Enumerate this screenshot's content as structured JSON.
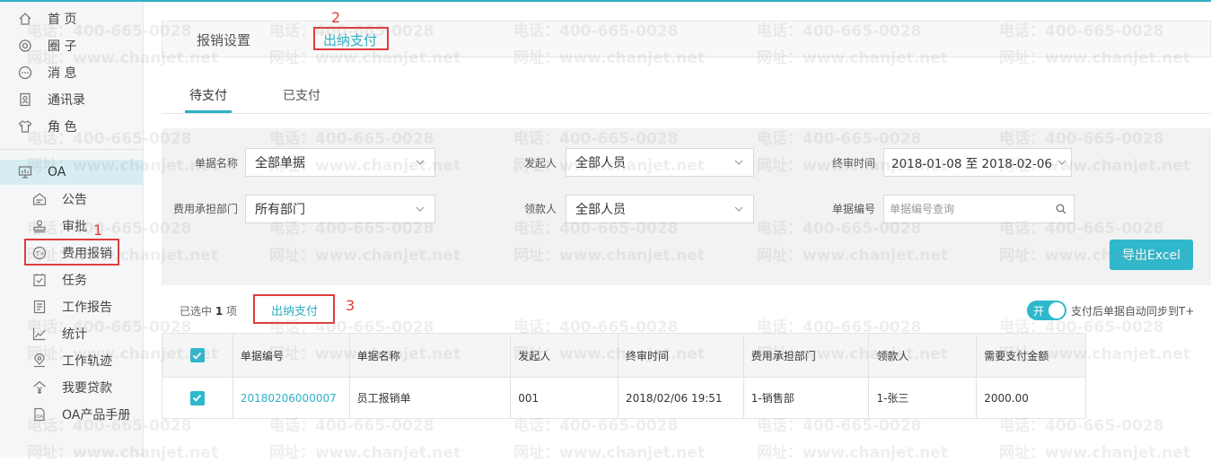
{
  "nav": {
    "home": "首 页",
    "circle": "圈 子",
    "message": "消 息",
    "contacts": "通讯录",
    "role": "角 色",
    "oa": "OA",
    "notice": "公告",
    "approval": "审批",
    "expense": "费用报销",
    "task": "任务",
    "report": "工作报告",
    "stats": "统计",
    "track": "工作轨迹",
    "loan": "我要贷款",
    "manual": "OA产品手册"
  },
  "header": {
    "tab_settings": "报销设置",
    "tab_cashier": "出纳支付"
  },
  "subtabs": {
    "pending": "待支付",
    "paid": "已支付"
  },
  "filters": {
    "doc_name_label": "单据名称",
    "doc_name_value": "全部单据",
    "initiator_label": "发起人",
    "initiator_value": "全部人员",
    "final_time_label": "终审时间",
    "final_time_value": "2018-01-08 至 2018-02-06",
    "dept_label": "费用承担部门",
    "dept_value": "所有部门",
    "payee_label": "领款人",
    "payee_value": "全部人员",
    "doc_no_label": "单据编号",
    "doc_no_placeholder": "单据编号查询",
    "export_label": "导出Excel"
  },
  "selection": {
    "prefix": "已选中",
    "count": "1",
    "suffix": "项",
    "pay_button": "出纳支付",
    "toggle_label": "开",
    "toggle_text": "支付后单据自动同步到T+"
  },
  "table": {
    "headers": [
      "单据编号",
      "单据名称",
      "发起人",
      "终审时间",
      "费用承担部门",
      "领款人",
      "需要支付金额"
    ],
    "rows": [
      [
        "20180206000007",
        "员工报销单",
        "001",
        "2018/02/06 19:51",
        "1-销售部",
        "1-张三",
        "2000.00"
      ]
    ]
  },
  "annotations": [
    "1",
    "2",
    "3"
  ],
  "watermark": {
    "phone": "电话：400-665-0028",
    "site": "网址：www.chanjet.net"
  },
  "colors": {
    "accent": "#2fb0c4",
    "annotation": "#e03c3c"
  }
}
